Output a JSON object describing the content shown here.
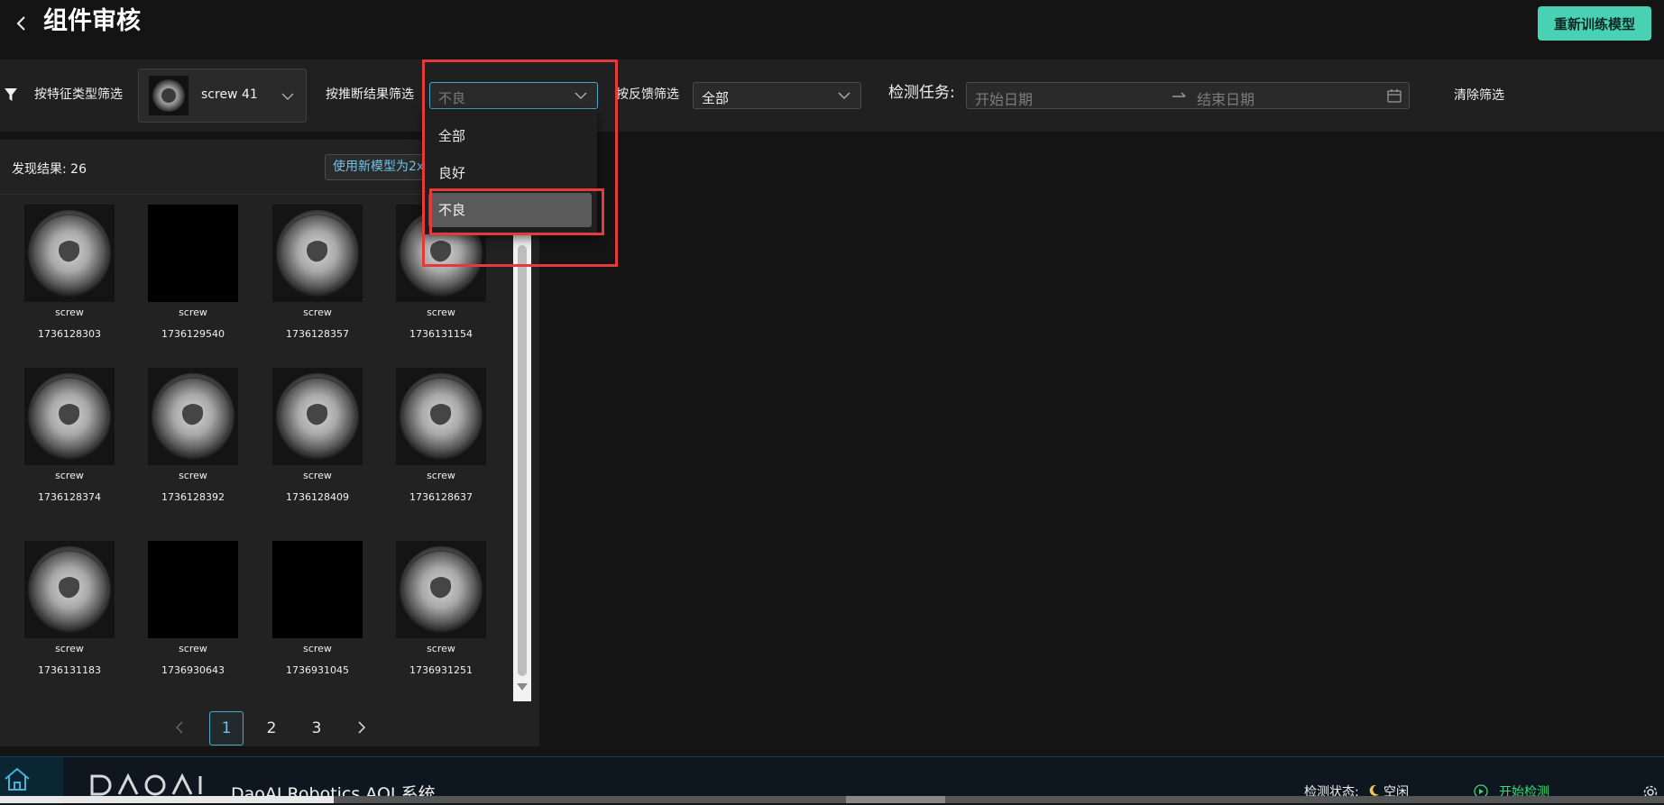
{
  "header": {
    "title": "组件审核",
    "retrain_label": "重新训练模型"
  },
  "filters": {
    "feature_label": "按特征类型筛选",
    "feature_value": "screw 41",
    "inference_label": "按推断结果筛选",
    "inference_value": "不良",
    "feedback_label": "按反馈筛选",
    "feedback_value": "全部",
    "task_label": "检测任务:",
    "start_date_placeholder": "开始日期",
    "end_date_placeholder": "结束日期",
    "clear_label": "清除筛选"
  },
  "results": {
    "count_text": "发现结果: 26",
    "use_model_label": "使用新模型为2x"
  },
  "tiles": [
    {
      "name": "screw",
      "id": "1736128303",
      "image": "screw"
    },
    {
      "name": "screw",
      "id": "1736129540",
      "image": "black"
    },
    {
      "name": "screw",
      "id": "1736128357",
      "image": "screw"
    },
    {
      "name": "screw",
      "id": "1736131154",
      "image": "screw"
    },
    {
      "name": "screw",
      "id": "1736128374",
      "image": "screw"
    },
    {
      "name": "screw",
      "id": "1736128392",
      "image": "screw"
    },
    {
      "name": "screw",
      "id": "1736128409",
      "image": "screw"
    },
    {
      "name": "screw",
      "id": "1736128637",
      "image": "screw"
    },
    {
      "name": "screw",
      "id": "1736131183",
      "image": "screw"
    },
    {
      "name": "screw",
      "id": "1736930643",
      "image": "black"
    },
    {
      "name": "screw",
      "id": "1736931045",
      "image": "black"
    },
    {
      "name": "screw",
      "id": "1736931251",
      "image": "screw"
    }
  ],
  "pagination": {
    "pages": [
      "1",
      "2",
      "3"
    ],
    "current": "1"
  },
  "dropdown": {
    "options": [
      "全部",
      "良好",
      "不良"
    ],
    "selected": "不良"
  },
  "footer": {
    "title": "DaoAI Robotics AOI 系统",
    "status_label": "检测状态:",
    "status_value": "空闲",
    "start_label": "开始检测"
  },
  "colors": {
    "accent": "#49d1b3",
    "link": "#6fc3e6",
    "highlight": "#e53a3a",
    "start": "#3dd67a"
  }
}
